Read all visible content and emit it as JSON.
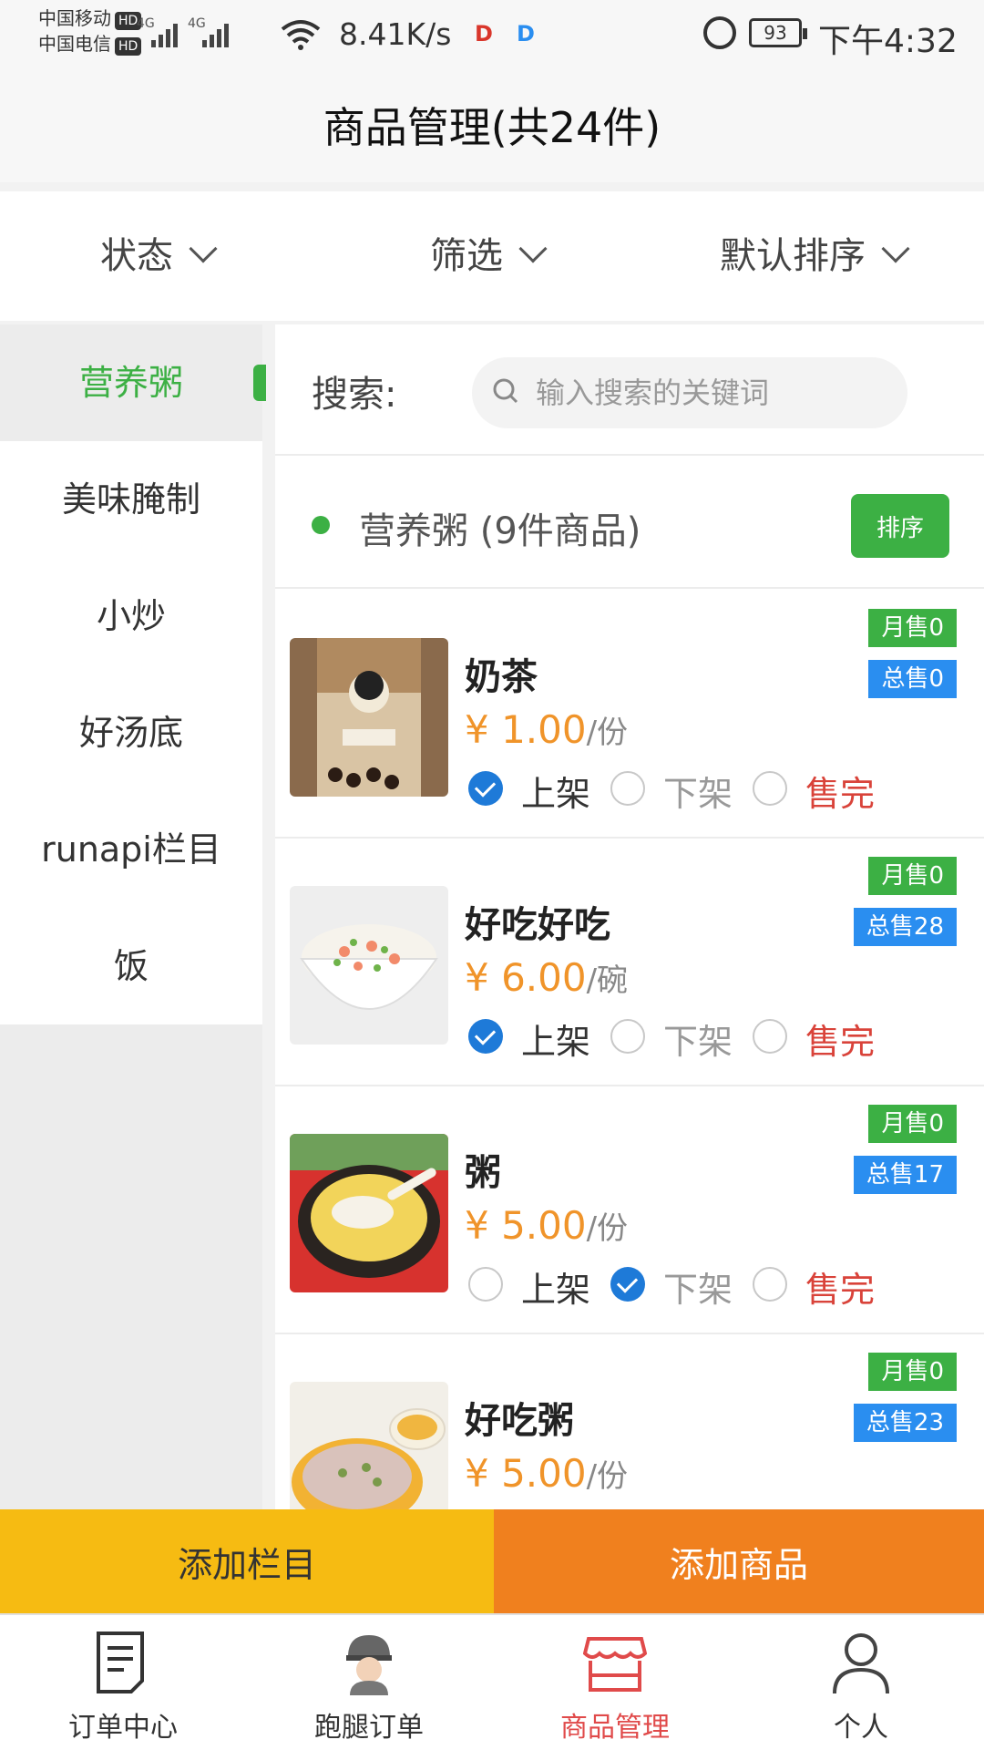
{
  "status_bar": {
    "carrier1": "中国移动",
    "carrier2": "中国电信",
    "hd": "HD",
    "network": "4G",
    "net_speed": "8.41K/s",
    "battery": "93",
    "time": "下午4:32"
  },
  "header": {
    "title": "商品管理(共24件)"
  },
  "filters": [
    {
      "label": "状态"
    },
    {
      "label": "筛选"
    },
    {
      "label": "默认排序"
    }
  ],
  "categories": [
    {
      "label": "营养粥",
      "active": true
    },
    {
      "label": "美味腌制"
    },
    {
      "label": "小炒"
    },
    {
      "label": "好汤底"
    },
    {
      "label": "runapi栏目"
    },
    {
      "label": "饭"
    }
  ],
  "search": {
    "label": "搜索:",
    "placeholder": "输入搜索的关键词"
  },
  "section": {
    "title": "营养粥 (9件商品)",
    "sort_label": "排序"
  },
  "status_options": {
    "on": "上架",
    "off": "下架",
    "sold_out": "售完"
  },
  "products": [
    {
      "name": "奶茶",
      "price": "¥ 1.00",
      "unit": "/份",
      "monthly": "月售0",
      "total": "总售0",
      "status": "on"
    },
    {
      "name": "好吃好吃",
      "price": "¥ 6.00",
      "unit": "/碗",
      "monthly": "月售0",
      "total": "总售28",
      "status": "on"
    },
    {
      "name": "粥",
      "price": "¥ 5.00",
      "unit": "/份",
      "monthly": "月售0",
      "total": "总售17",
      "status": "off"
    },
    {
      "name": "好吃粥",
      "price": "¥ 5.00",
      "unit": "/份",
      "monthly": "月售0",
      "total": "总售23",
      "status": "on"
    }
  ],
  "actions": {
    "add_column": "添加栏目",
    "add_product": "添加商品"
  },
  "tabs": [
    {
      "label": "订单中心",
      "icon": "document-icon"
    },
    {
      "label": "跑腿订单",
      "icon": "courier-icon"
    },
    {
      "label": "商品管理",
      "icon": "store-icon",
      "active": true
    },
    {
      "label": "个人",
      "icon": "person-icon"
    }
  ],
  "colors": {
    "accent_green": "#3cb044",
    "price_orange": "#f0942a",
    "badge_blue": "#2a8ef0",
    "add_column_yellow": "#f6bb12",
    "add_product_orange": "#f0801e",
    "active_tab_red": "#e04a4a",
    "sold_out_red": "#d9433a"
  }
}
